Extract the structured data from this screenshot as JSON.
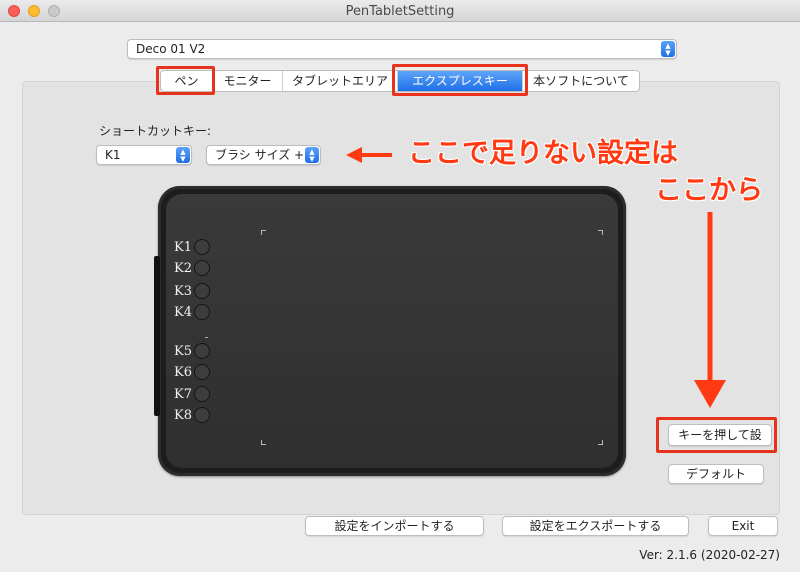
{
  "window": {
    "title": "PenTabletSetting"
  },
  "device_select": {
    "value": "Deco 01 V2"
  },
  "tabs": [
    {
      "label": "ペン"
    },
    {
      "label": "モニター"
    },
    {
      "label": "タブレットエリア"
    },
    {
      "label": "エクスプレスキー",
      "active": true
    },
    {
      "label": "本ソフトについて"
    }
  ],
  "express": {
    "shortcut_label": "ショートカットキー:",
    "key_select": "K1",
    "function_select": "ブラシ サイズ +",
    "keys": [
      "K1",
      "K2",
      "K3",
      "K4",
      "K5",
      "K6",
      "K7",
      "K8"
    ]
  },
  "buttons": {
    "press_key": "キーを押して設",
    "default": "デフォルト",
    "import": "設定をインポートする",
    "export": "設定をエクスポートする",
    "exit": "Exit"
  },
  "version": "Ver: 2.1.6 (2020-02-27)",
  "annotations": {
    "line1": "ここで足りない設定は",
    "line2": "ここから"
  },
  "colors": {
    "accent": "#1f6fe5",
    "annotation": "#ff3a12",
    "highlight_box": "#e8331c"
  }
}
